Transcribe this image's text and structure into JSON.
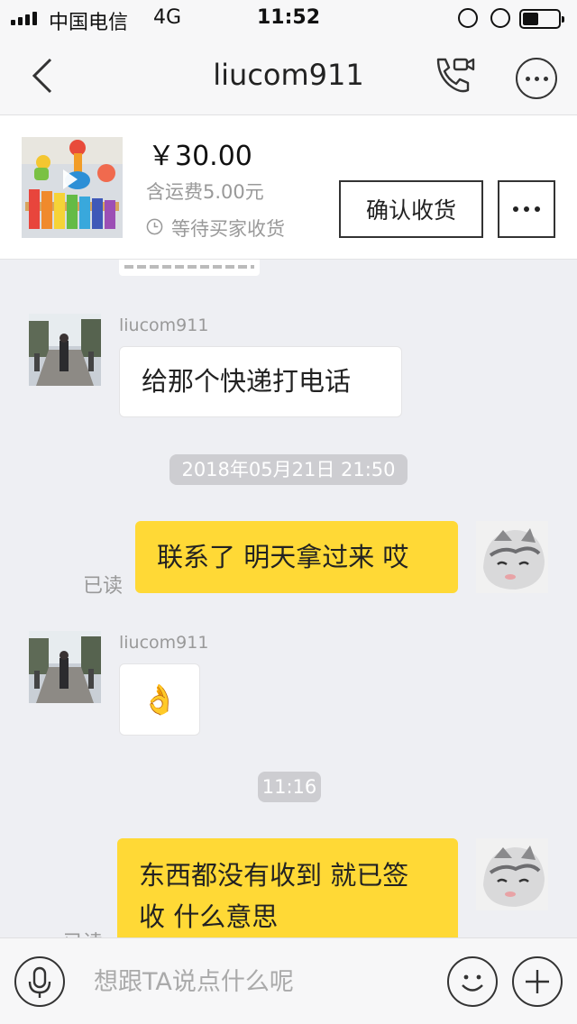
{
  "status_bar": {
    "carrier": "中国电信",
    "network": "4G",
    "time": "11:52",
    "battery_level": 0.45
  },
  "nav": {
    "title": "liucom911"
  },
  "order": {
    "price": "￥30.00",
    "shipping": "含运费5.00元",
    "status": "等待买家收货",
    "confirm_label": "确认收货"
  },
  "messages": [
    {
      "sender": "liucom911",
      "text": "给那个快递打电话"
    },
    {
      "timestamp": "2018年05月21日  21:50"
    },
    {
      "text": "联系了 明天拿过来 哎",
      "read": "已读"
    },
    {
      "sender": "liucom911",
      "emoji": "👌"
    },
    {
      "timestamp": "11:16"
    },
    {
      "line1": "东西都没有收到 就已签",
      "line2": "收 什么意思",
      "read": "已读"
    }
  ],
  "input": {
    "placeholder": "想跟TA说点什么呢"
  },
  "colors": {
    "outgoing_bubble": "#ffd936",
    "chat_background": "#eeeff3"
  }
}
